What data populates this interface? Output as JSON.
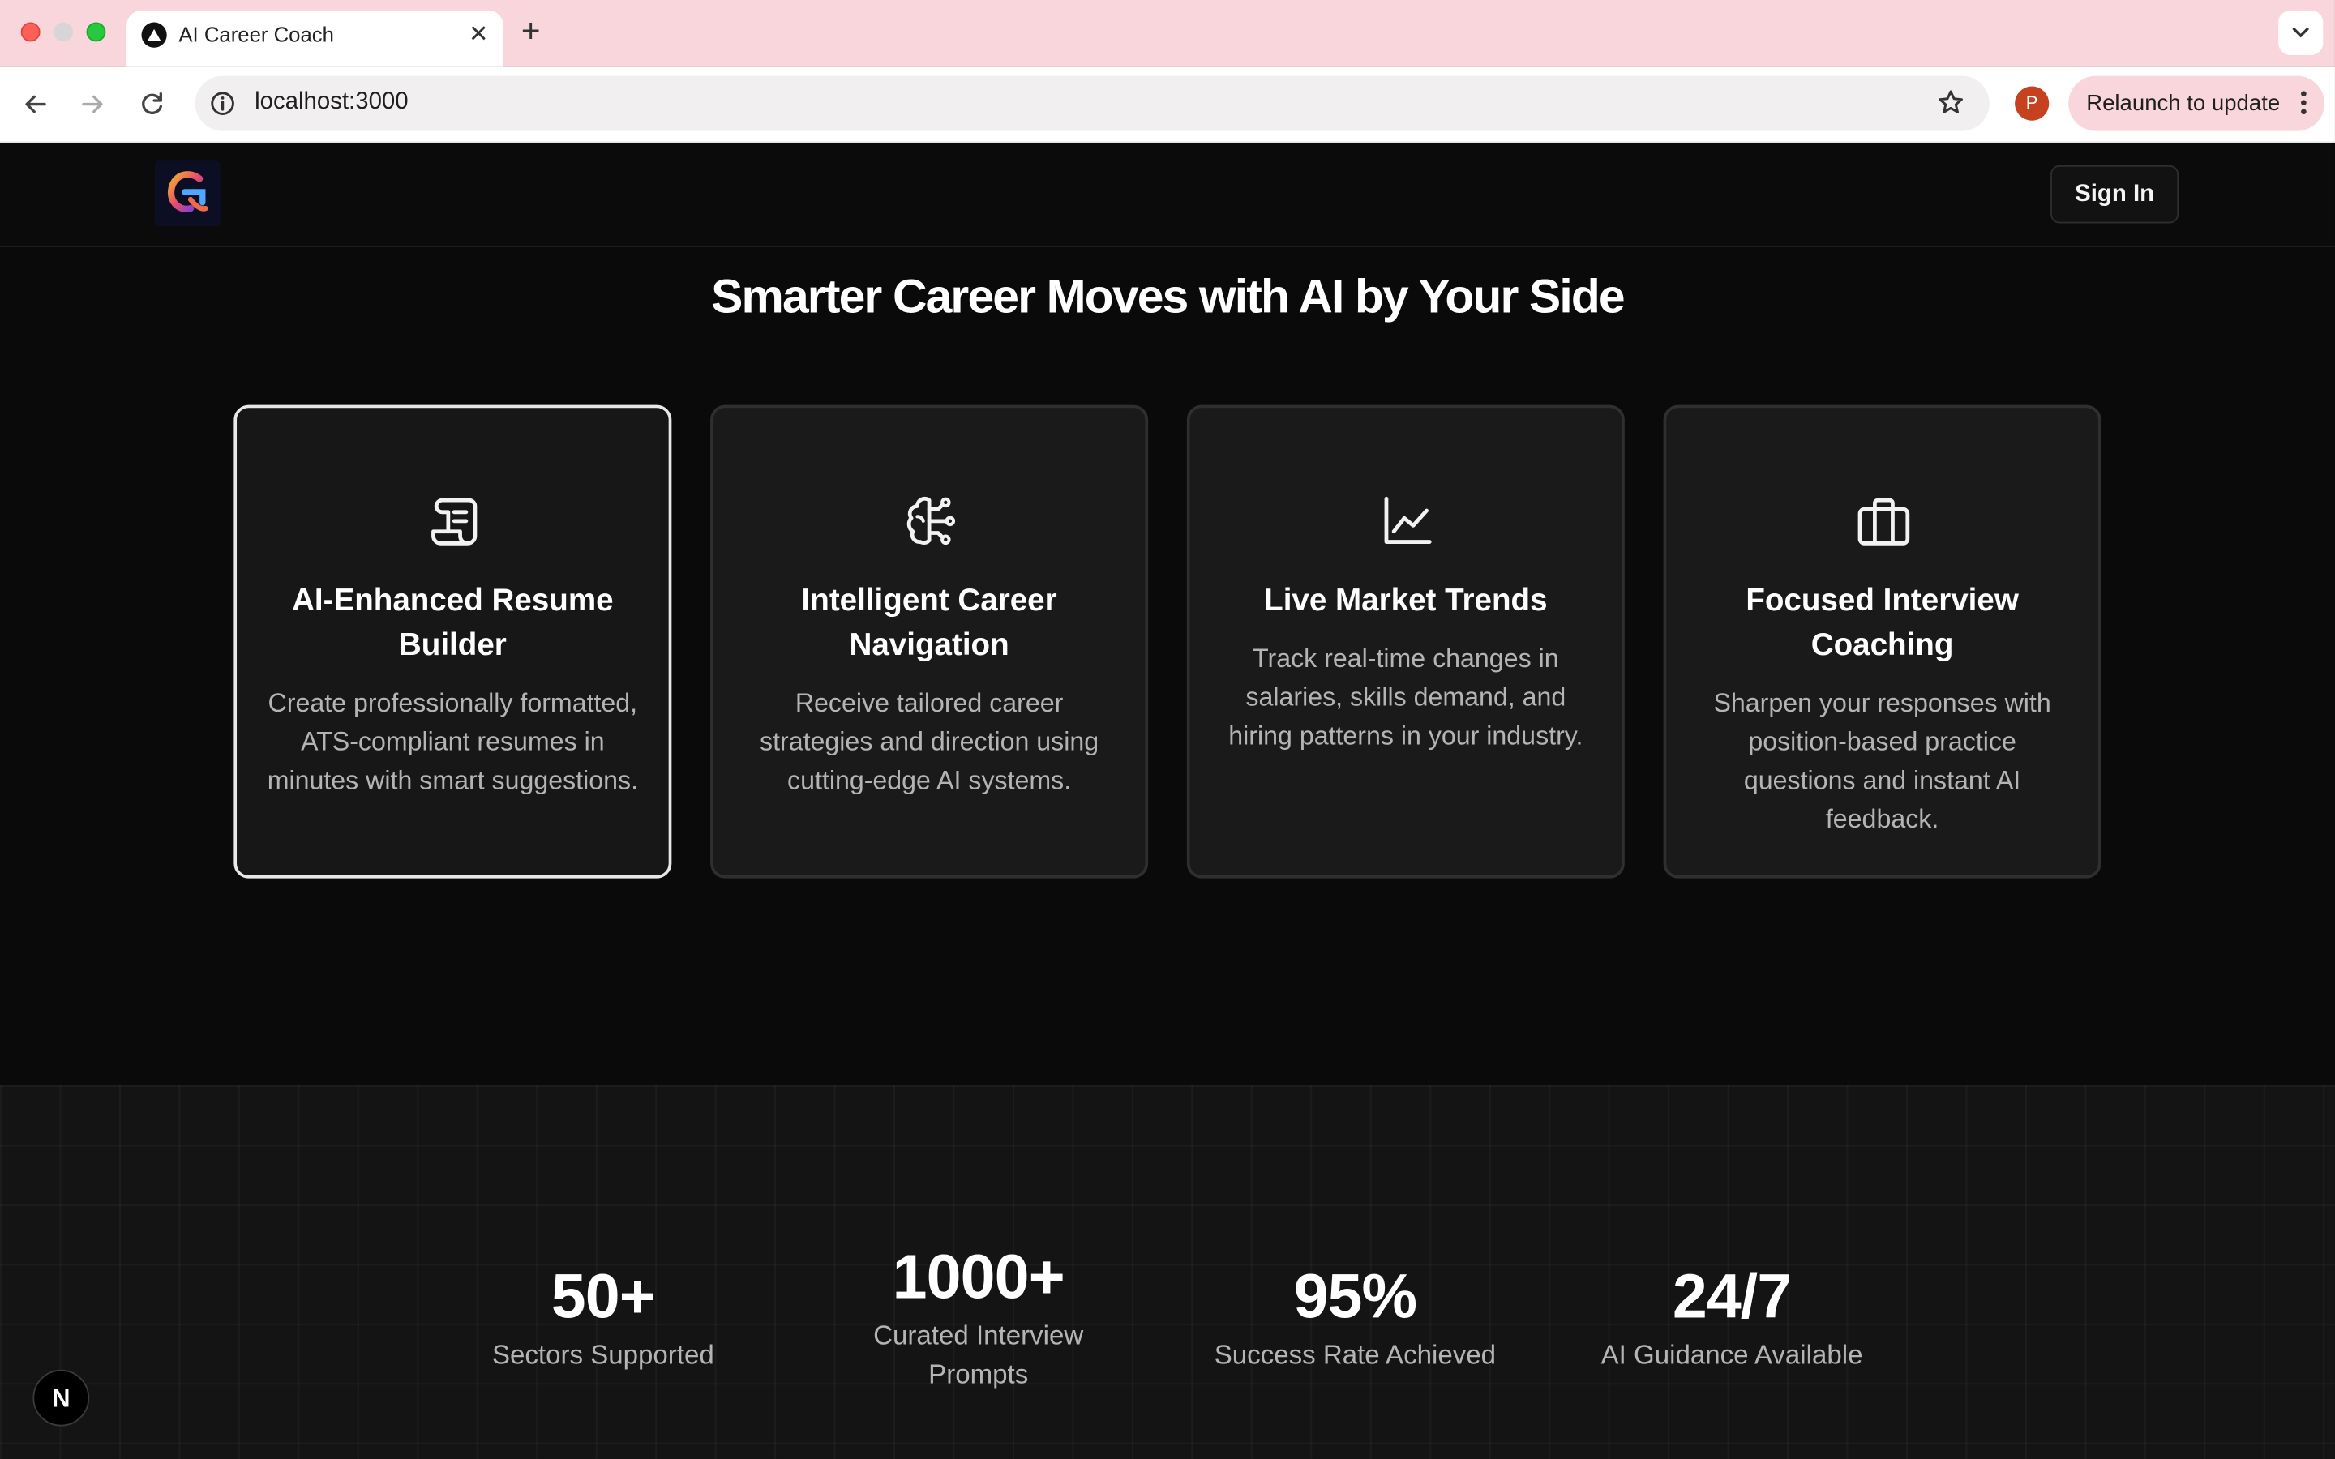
{
  "browser": {
    "tab_title": "AI Career Coach",
    "close_glyph": "✕",
    "new_tab_glyph": "+",
    "url": "localhost:3000",
    "profile_initial": "P",
    "relaunch_label": "Relaunch to update"
  },
  "header": {
    "sign_in_label": "Sign In"
  },
  "features": {
    "title": "Smarter Career Moves with AI by Your Side",
    "cards": [
      {
        "icon": "scroll-icon",
        "title": "AI-Enhanced Resume Builder",
        "description": "Create professionally formatted, ATS-compliant resumes in minutes with smart suggestions."
      },
      {
        "icon": "brain-circuit-icon",
        "title": "Intelligent Career Navigation",
        "description": "Receive tailored career strategies and direction using cutting-edge AI systems."
      },
      {
        "icon": "line-chart-icon",
        "title": "Live Market Trends",
        "description": "Track real-time changes in salaries, skills demand, and hiring patterns in your industry."
      },
      {
        "icon": "briefcase-icon",
        "title": "Focused Interview Coaching",
        "description": "Sharpen your responses with position-based practice questions and instant AI feedback."
      }
    ]
  },
  "stats": [
    {
      "value": "50+",
      "label": "Sectors Supported"
    },
    {
      "value": "1000+",
      "label": "Curated Interview Prompts"
    },
    {
      "value": "95%",
      "label": "Success Rate Achieved"
    },
    {
      "value": "24/7",
      "label": "AI Guidance Available"
    }
  ],
  "dev_badge": "N",
  "colors": {
    "page_bg": "#0a0a0a",
    "card_bg": "#1a1a1a",
    "tab_strip": "#f9d6dc",
    "text_primary": "#ffffff",
    "text_muted": "#b4b4b4"
  }
}
